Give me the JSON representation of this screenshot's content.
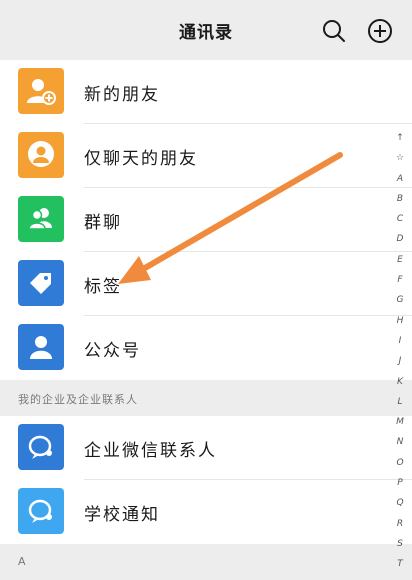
{
  "header": {
    "title": "通讯录",
    "search_icon": "search-icon",
    "add_icon": "plus-circle-icon"
  },
  "rows": [
    {
      "label": "新的朋友",
      "icon": "add-friend-icon",
      "color": "#f5a033"
    },
    {
      "label": "仅聊天的朋友",
      "icon": "chat-only-friend-icon",
      "color": "#f5a033"
    },
    {
      "label": "群聊",
      "icon": "group-chat-icon",
      "color": "#22c05e"
    },
    {
      "label": "标签",
      "icon": "tag-icon",
      "color": "#2f7bd6"
    },
    {
      "label": "公众号",
      "icon": "official-account-icon",
      "color": "#2f7bd6"
    }
  ],
  "section1": {
    "title": "我的企业及企业联系人"
  },
  "enterprise_rows": [
    {
      "label": "企业微信联系人",
      "icon": "wecom-contact-icon",
      "color": "#2f7bd6"
    },
    {
      "label": "学校通知",
      "icon": "school-notice-icon",
      "color": "#3fa6f0"
    }
  ],
  "section2": {
    "title": "A"
  },
  "index_letters": [
    "↑",
    "☆",
    "A",
    "B",
    "C",
    "D",
    "E",
    "F",
    "G",
    "H",
    "I",
    "J",
    "K",
    "L",
    "M",
    "N",
    "O",
    "P",
    "Q",
    "R",
    "S",
    "T"
  ],
  "annotation": {
    "arrow_color": "#f08a3c",
    "icon": "orange-arrow-annotation"
  }
}
